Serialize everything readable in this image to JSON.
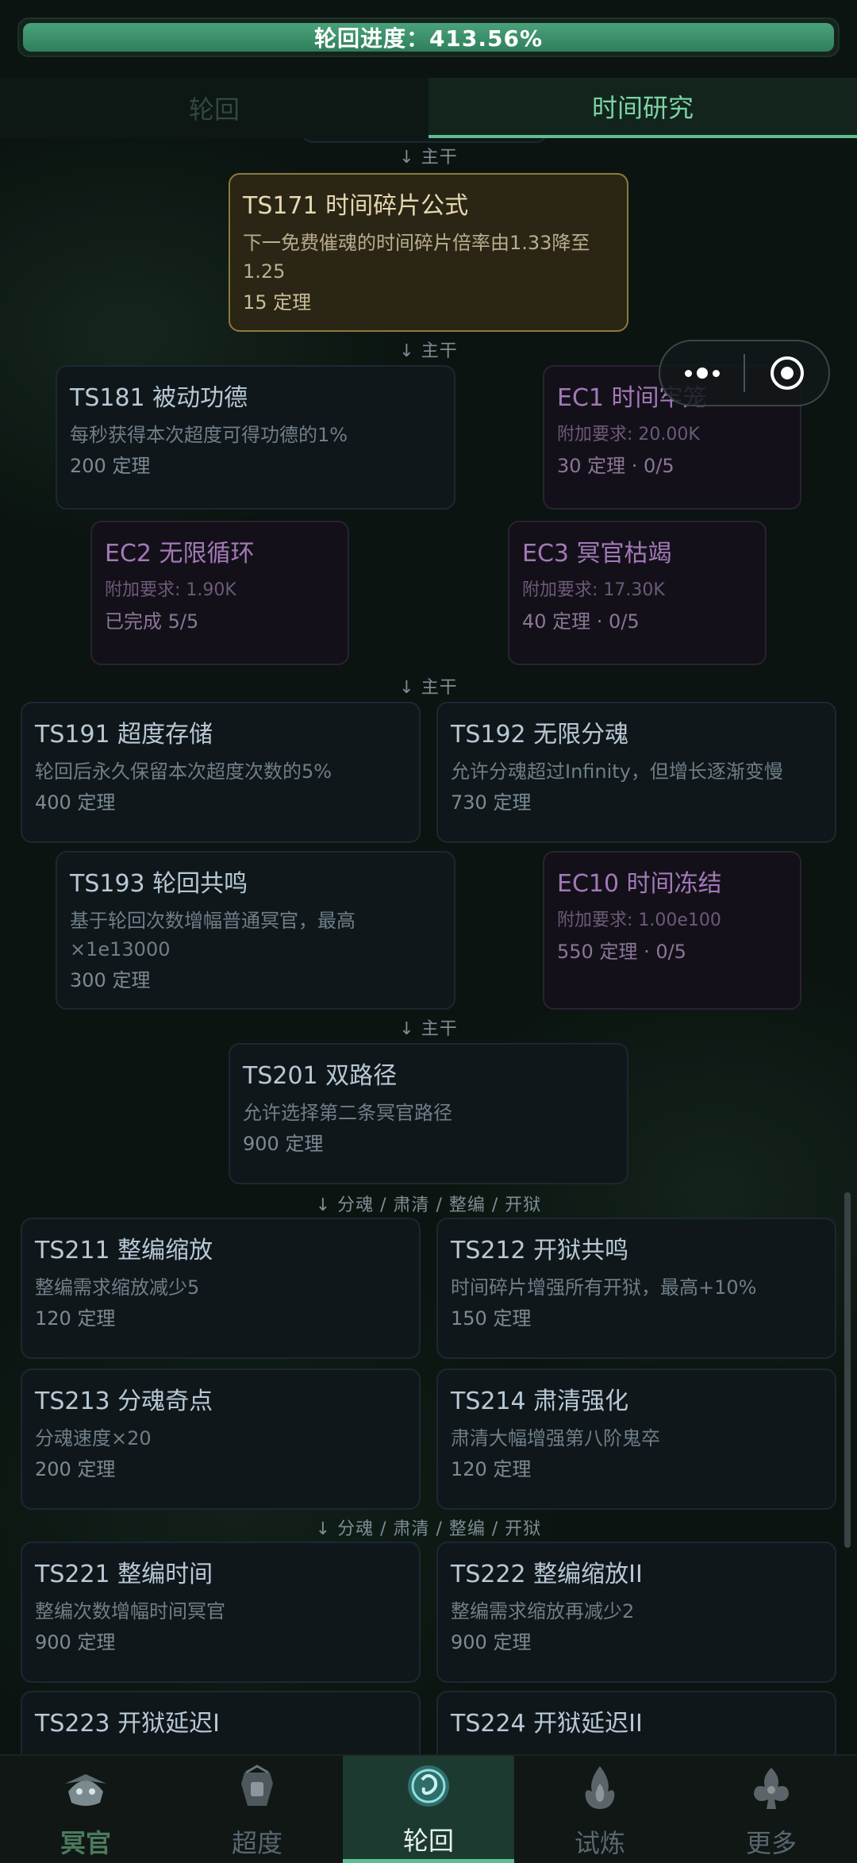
{
  "progress": {
    "label": "轮回进度：413.56%",
    "value_percent": 413.56
  },
  "tabs": [
    {
      "label": "轮回",
      "active": false
    },
    {
      "label": "时间研究",
      "active": true
    }
  ],
  "arrows": {
    "a1": "↓ 主干",
    "a2": "↓ 主干",
    "a3": "↓ 主干",
    "a4": "↓ 主干",
    "a5": "↓ 分魂 / 肃清 / 整编 / 开狱",
    "a6": "↓ 分魂 / 肃清 / 整编 / 开狱"
  },
  "studies": {
    "ts171": {
      "title": "TS171 时间碎片公式",
      "desc": "下一免费催魂的时间碎片倍率由1.33降至1.25",
      "cost": "15 定理"
    },
    "ts181": {
      "title": "TS181 被动功德",
      "desc": "每秒获得本次超度可得功德的1%",
      "cost": "200 定理"
    },
    "ec1": {
      "title": "EC1 时间牢笼",
      "desc": "附加要求: 20.00K",
      "cost": "30 定理 · 0/5"
    },
    "ec2": {
      "title": "EC2 无限循环",
      "desc": "附加要求: 1.90K",
      "cost": "已完成 5/5"
    },
    "ec3": {
      "title": "EC3 冥官枯竭",
      "desc": "附加要求: 17.30K",
      "cost": "40 定理 · 0/5"
    },
    "ts191": {
      "title": "TS191 超度存储",
      "desc": "轮回后永久保留本次超度次数的5%",
      "cost": "400 定理"
    },
    "ts192": {
      "title": "TS192 无限分魂",
      "desc": "允许分魂超过Infinity，但增长逐渐变慢",
      "cost": "730 定理"
    },
    "ts193": {
      "title": "TS193 轮回共鸣",
      "desc": "基于轮回次数增幅普通冥官，最高×1e13000",
      "cost": "300 定理"
    },
    "ec10": {
      "title": "EC10 时间冻结",
      "desc": "附加要求: 1.00e100",
      "cost": "550 定理 · 0/5"
    },
    "ts201": {
      "title": "TS201 双路径",
      "desc": "允许选择第二条冥官路径",
      "cost": "900 定理"
    },
    "ts211": {
      "title": "TS211 整编缩放",
      "desc": "整编需求缩放减少5",
      "cost": "120 定理"
    },
    "ts212": {
      "title": "TS212 开狱共鸣",
      "desc": "时间碎片增强所有开狱，最高+10%",
      "cost": "150 定理"
    },
    "ts213": {
      "title": "TS213 分魂奇点",
      "desc": "分魂速度×20",
      "cost": "200 定理"
    },
    "ts214": {
      "title": "TS214 肃清强化",
      "desc": "肃清大幅增强第八阶鬼卒",
      "cost": "120 定理"
    },
    "ts221": {
      "title": "TS221 整编时间",
      "desc": "整编次数增幅时间冥官",
      "cost": "900 定理"
    },
    "ts222": {
      "title": "TS222 整编缩放II",
      "desc": "整编需求缩放再减少2",
      "cost": "900 定理"
    },
    "ts223": {
      "title": "TS223 开狱延迟I"
    },
    "ts224": {
      "title": "TS224 开狱延迟II"
    }
  },
  "nav": [
    {
      "label": "冥官",
      "icon": "ghost-official-icon"
    },
    {
      "label": "超度",
      "icon": "spirit-release-icon"
    },
    {
      "label": "轮回",
      "icon": "reincarnation-icon"
    },
    {
      "label": "试炼",
      "icon": "trial-flame-icon"
    },
    {
      "label": "更多",
      "icon": "more-icon"
    }
  ],
  "colors": {
    "accent": "#5dbf8f",
    "progress": "#3f9470",
    "highlight_border": "#8c7a3c",
    "ec_title": "#a279b8"
  }
}
